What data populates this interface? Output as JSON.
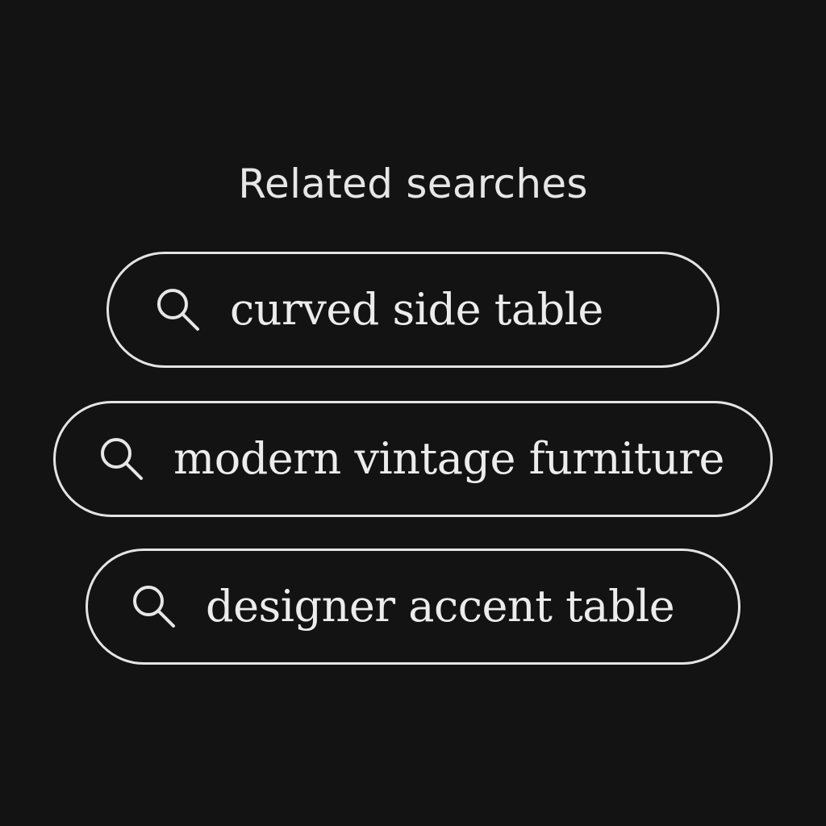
{
  "related_searches": {
    "heading": "Related searches",
    "items": [
      {
        "label": "curved side table",
        "icon": "search-icon"
      },
      {
        "label": "modern vintage furniture",
        "icon": "search-icon"
      },
      {
        "label": "designer accent table",
        "icon": "search-icon"
      }
    ]
  },
  "colors": {
    "background": "#131313",
    "foreground": "#e6e6e6",
    "chip_border": "#e4e4e4"
  }
}
